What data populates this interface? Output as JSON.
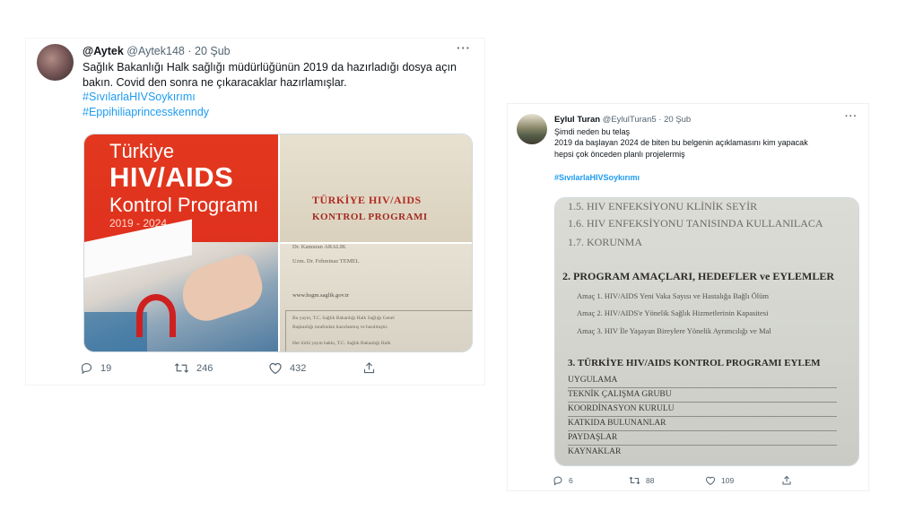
{
  "tweets": [
    {
      "name": "@Aytek",
      "handle": "@Aytek148",
      "sep": "·",
      "date": "20 Şub",
      "more": "···",
      "text_lines": [
        "Sağlık Bakanlığı Halk sağlığı müdürlüğünün 2019 da hazırladığı dosya açın",
        "bakın. Covid den sonra ne çıkaracaklar hazırlamışlar."
      ],
      "hashtags": [
        "#SıvılarlaHIVSoykırımı",
        "#Eppihiliaprincesskenndy"
      ],
      "media": {
        "cover_line1": "Türkiye",
        "cover_line2": "HIV/AIDS",
        "cover_line3": "Kontrol Programı",
        "cover_line4": "2019 - 2024",
        "doc_title1": "TÜRKİYE HIV/AIDS",
        "doc_title2": "KONTROL PROGRAMI",
        "doc_small1": "Dr. Kamuran ARALIK",
        "doc_small2": "Uzm. Dr. Fehminaz TEMEL",
        "doc_small3": "www.hsgm.saglik.gov.tr",
        "doc_small4": "Bu yayın, T.C. Sağlık Bakanlığı Halk Sağlığı Genel",
        "doc_small5": "Başkanlığı tarafından hazırlanmış ve basılmıştır.",
        "doc_small6": "Her türlü yayın hakkı, T.C. Sağlık Bakanlığı Halk"
      },
      "actions": {
        "replies": "19",
        "retweets": "246",
        "likes": "432"
      }
    },
    {
      "name": "Eylul Turan",
      "handle": "@EylulTuran5",
      "sep": "·",
      "date": "20 Şub",
      "more": "···",
      "text_lines": [
        "Şimdi neden bu telaş",
        "2019 da  başlayan 2024 de biten bu belgenin açıklamasını kim yapacak",
        "hepsi çok önceden planlı projelermiş"
      ],
      "hashtags": [
        "#SıvılarlaHIVSoykırımı"
      ],
      "media": {
        "l1": "1.5. HIV ENFEKSİYONU KLİNİK SEYİR",
        "l2": "1.6. HIV ENFEKSİYONU TANISINDA KULLANILACA",
        "l3": "1.7. KORUNMA",
        "h1": "2. PROGRAM AMAÇLARI, HEDEFLER ve EYLEMLER",
        "a1": "Amaç 1. HIV/AIDS Yeni Vaka Sayısı ve Hastalığa Bağlı Ölüm",
        "a2": "Amaç 2. HIV/AIDS'e Yönelik Sağlık Hizmetlerinin Kapasitesi",
        "a3": "Amaç 3. HIV İle Yaşayan Bireylere Yönelik Ayrımcılığı ve Mal",
        "h2": "3. TÜRKİYE HIV/AIDS KONTROL PROGRAMI EYLEM",
        "u1": "UYGULAMA",
        "u2": "TEKNİK ÇALIŞMA GRUBU",
        "u3": "KOORDİNASYON KURULU",
        "u4": "KATKIDA BULUNANLAR",
        "u5": "PAYDAŞLAR",
        "u6": "KAYNAKLAR"
      },
      "actions": {
        "replies": "6",
        "retweets": "88",
        "likes": "109"
      }
    }
  ],
  "colors": {
    "link": "#1d9bf0",
    "muted": "#536471",
    "cover_red": "#e3381f"
  },
  "icons": [
    "reply-icon",
    "retweet-icon",
    "like-icon",
    "share-icon",
    "more-icon"
  ]
}
